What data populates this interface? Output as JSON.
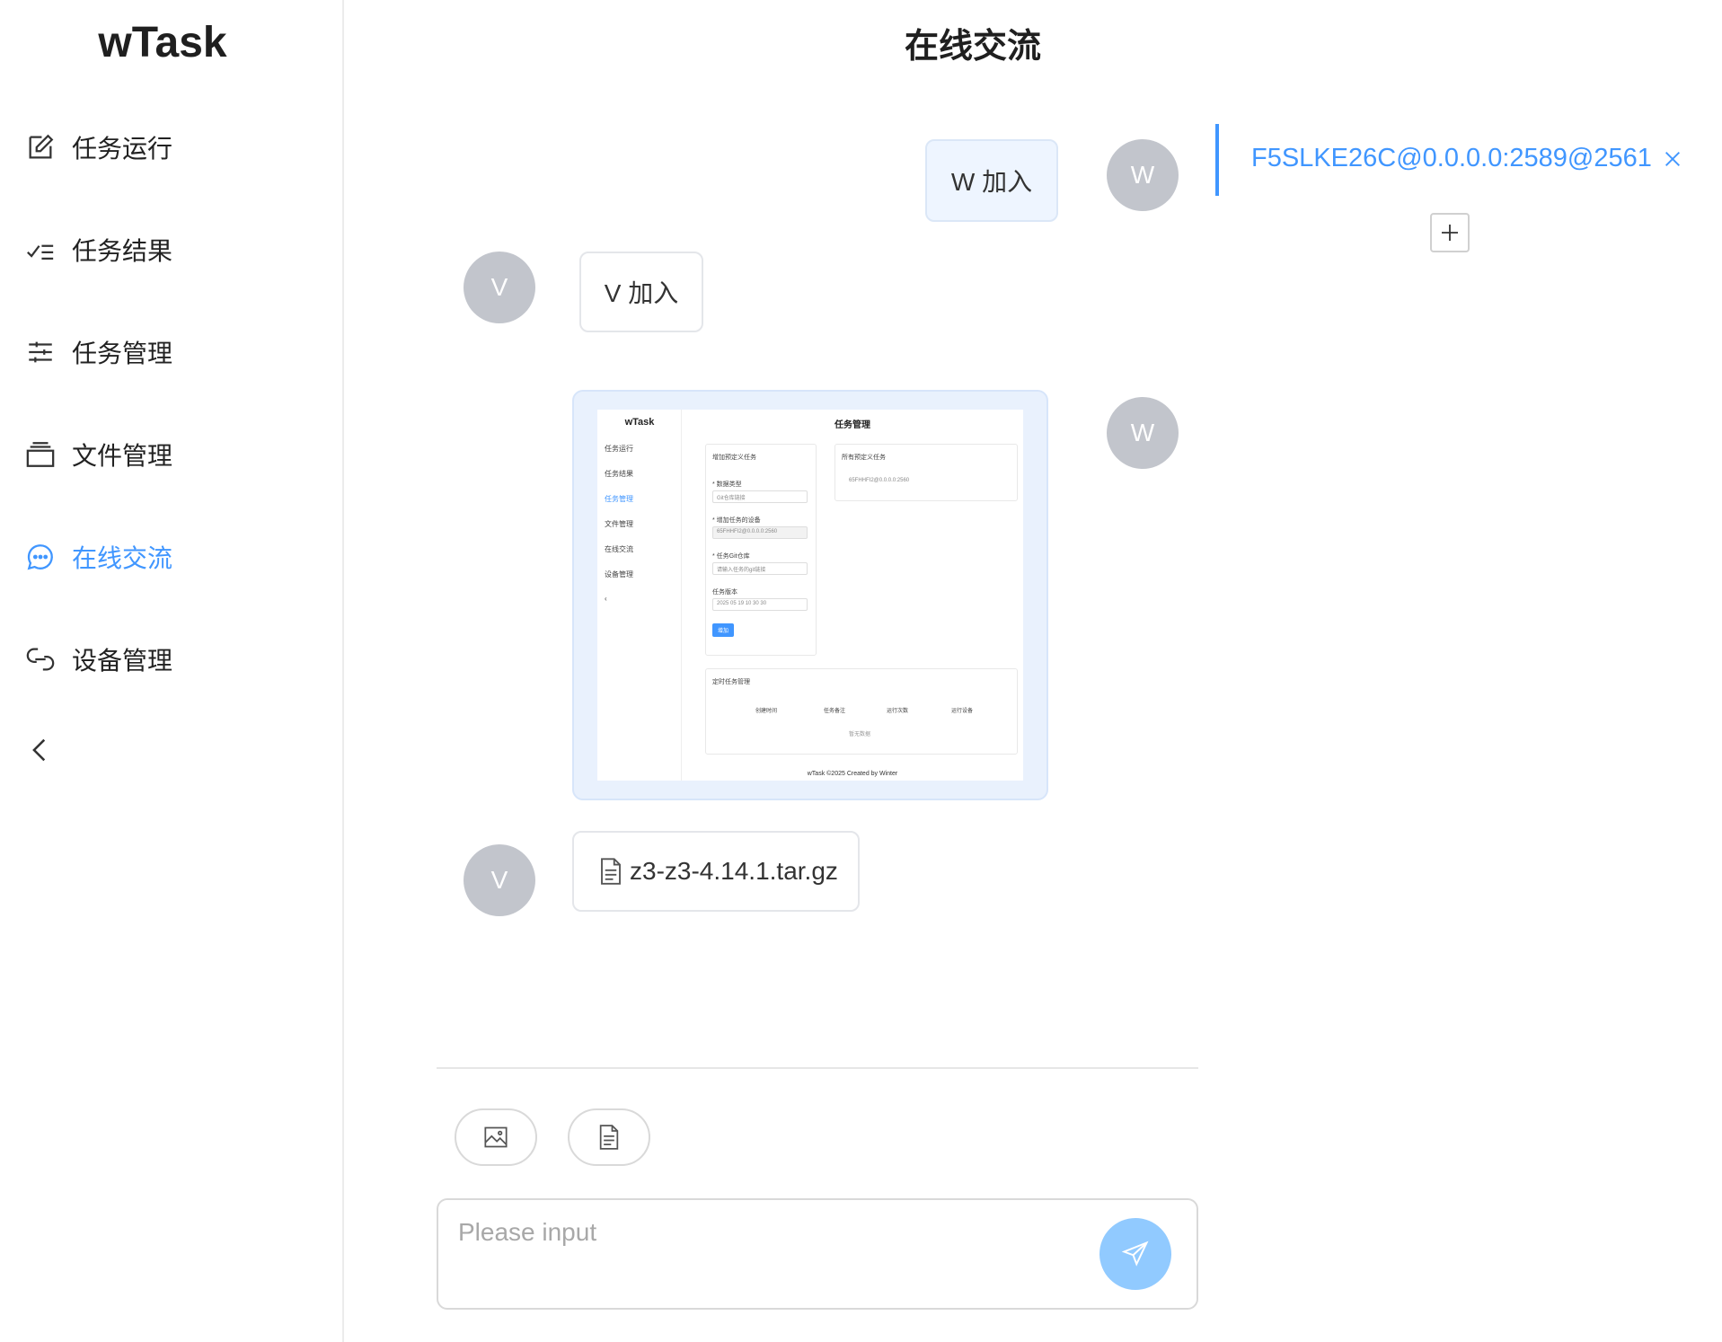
{
  "app": {
    "logo": "wTask"
  },
  "sidebar": {
    "items": [
      {
        "label": "任务运行",
        "icon": "edit-icon"
      },
      {
        "label": "任务结果",
        "icon": "checklist-icon"
      },
      {
        "label": "任务管理",
        "icon": "sliders-icon"
      },
      {
        "label": "文件管理",
        "icon": "folder-stack-icon"
      },
      {
        "label": "在线交流",
        "icon": "chat-icon",
        "active": true
      },
      {
        "label": "设备管理",
        "icon": "link-device-icon"
      }
    ],
    "collapse_icon": "chevron-left-icon"
  },
  "header": {
    "title": "在线交流"
  },
  "chat": {
    "messages": [
      {
        "from": "self",
        "avatar": "W",
        "type": "text",
        "text": "W 加入"
      },
      {
        "from": "other",
        "avatar": "V",
        "type": "text",
        "text": "V 加入"
      },
      {
        "from": "self",
        "avatar": "W",
        "type": "image"
      },
      {
        "from": "other",
        "avatar": "V",
        "type": "file",
        "file_name": "z3-z3-4.14.1.tar.gz"
      }
    ],
    "screenshot": {
      "logo": "wTask",
      "title": "任务管理",
      "menu": [
        "任务运行",
        "任务结果",
        "任务管理",
        "文件管理",
        "在线交流",
        "设备管理"
      ],
      "card1_title": "增加预定义任务",
      "card2_title": "所有预定义任务",
      "card2_item": "65FHHFI2@0.0.0.0:2560",
      "field1_label": "* 数据类型",
      "field1_value": "Git仓库链接",
      "field2_label": "* 增加任务的设备",
      "field2_value": "65FHHFI2@0.0.0.0:2560",
      "field3_label": "* 任务Git仓库",
      "field3_value": "请输入任务的git链接",
      "field4_label": "任务版本",
      "field4_value": "2025 05 19 10 30 30",
      "add_button": "增加",
      "card3_title": "定时任务管理",
      "table_headers": [
        "创建时间",
        "任务备注",
        "运行次数",
        "运行设备"
      ],
      "empty": "暂无数据",
      "footer": "wTask ©2025 Created by Winter"
    }
  },
  "composer": {
    "image_button_icon": "image-icon",
    "file_button_icon": "file-icon",
    "placeholder": "Please input",
    "send_icon": "send-icon"
  },
  "sessions": {
    "tabs": [
      {
        "label": "F5SLKE26C@0.0.0.0:2589@2561",
        "active": true
      }
    ],
    "add_icon": "plus-icon"
  },
  "colors": {
    "accent": "#4096ff",
    "send_bg": "#91caff",
    "avatar_bg": "#c2c5cc"
  }
}
